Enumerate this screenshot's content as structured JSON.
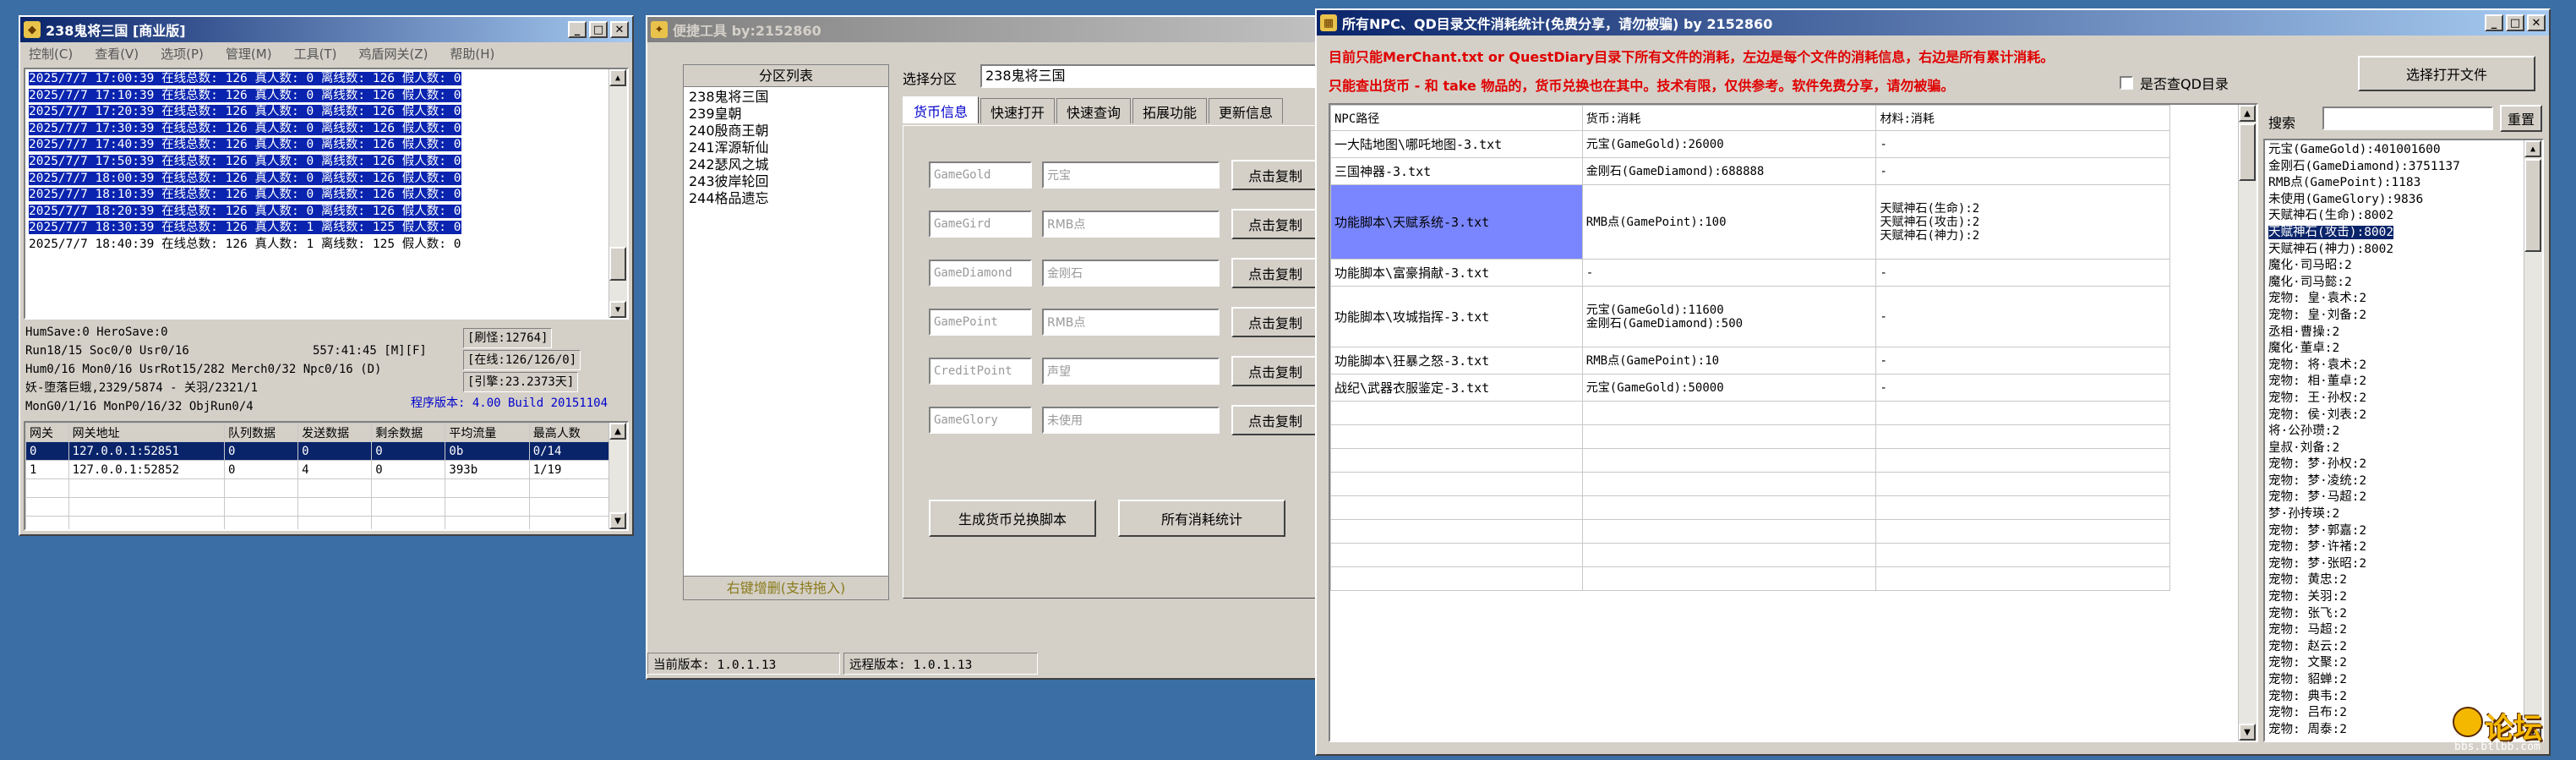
{
  "win1": {
    "title": "238鬼将三国 [商业版]",
    "menu": [
      "控制(C)",
      "查看(V)",
      "选项(P)",
      "管理(M)",
      "工具(T)",
      "鸡盾网关(Z)",
      "帮助(H)"
    ],
    "log": [
      {
        "text": "2025/7/7 17:00:39 在线总数: 126 真人数: 0 离线数: 126 假人数: 0",
        "selected": true
      },
      {
        "text": "2025/7/7 17:10:39 在线总数: 126 真人数: 0 离线数: 126 假人数: 0",
        "selected": true
      },
      {
        "text": "2025/7/7 17:20:39 在线总数: 126 真人数: 0 离线数: 126 假人数: 0",
        "selected": true
      },
      {
        "text": "2025/7/7 17:30:39 在线总数: 126 真人数: 0 离线数: 126 假人数: 0",
        "selected": true
      },
      {
        "text": "2025/7/7 17:40:39 在线总数: 126 真人数: 0 离线数: 126 假人数: 0",
        "selected": true
      },
      {
        "text": "2025/7/7 17:50:39 在线总数: 126 真人数: 0 离线数: 126 假人数: 0",
        "selected": true
      },
      {
        "text": "2025/7/7 18:00:39 在线总数: 126 真人数: 0 离线数: 126 假人数: 0",
        "selected": true
      },
      {
        "text": "2025/7/7 18:10:39 在线总数: 126 真人数: 0 离线数: 126 假人数: 0",
        "selected": true
      },
      {
        "text": "2025/7/7 18:20:39 在线总数: 126 真人数: 0 离线数: 126 假人数: 0",
        "selected": true
      },
      {
        "text": "2025/7/7 18:30:39 在线总数: 126 真人数: 1 离线数: 125 假人数: 0",
        "selected": true
      },
      {
        "text": "2025/7/7 18:40:39 在线总数: 126 真人数: 1 离线数: 125 假人数: 0",
        "selected": false
      }
    ],
    "stats": {
      "line1": "HumSave:0 HeroSave:0",
      "line2": "Run18/15 Soc0/0 Usr0/16",
      "uptime": "557:41:45 [M][F]",
      "refresh": "[刷怪:12764]",
      "online": "[在线:126/126/0]",
      "line3": "Hum0/16 Mon0/16 UsrRot15/282 Merch0/32 Npc0/16 (D)",
      "engine": "[引擎:23.2373天]",
      "line4": "妖-堕落巨蛾,2329/5874 - 关羽/2321/1",
      "line5": "MonG0/1/16 MonP0/16/32 ObjRun0/4",
      "version": "程序版本: 4.00 Build 20151104"
    },
    "gateway": {
      "headers": [
        "网关",
        "网关地址",
        "队列数据",
        "发送数据",
        "剩余数据",
        "平均流量",
        "最高人数"
      ],
      "rows": [
        [
          "0",
          "127.0.0.1:52851",
          "0",
          "0",
          "0",
          "0b",
          "0/14"
        ],
        [
          "1",
          "127.0.0.1:52852",
          "0",
          "4",
          "0",
          "393b",
          "1/19"
        ]
      ]
    }
  },
  "win2": {
    "title": "便捷工具   by:2152860",
    "zone_list_header": "分区列表",
    "zones": [
      "238鬼将三国",
      "239皇朝",
      "240殷商王朝",
      "241浑源斩仙",
      "242瑟风之城",
      "243彼岸轮回",
      "244格品遗忘"
    ],
    "zone_footer": "右键增删(支持拖入)",
    "select_zone_label": "选择分区",
    "select_zone_value": "238鬼将三国",
    "tabs": [
      "货币信息",
      "快速打开",
      "快速查询",
      "拓展功能",
      "更新信息"
    ],
    "currency_rows": [
      {
        "code": "GameGold",
        "name": "元宝",
        "button": "点击复制"
      },
      {
        "code": "GameGird",
        "name": "RMB点",
        "button": "点击复制"
      },
      {
        "code": "GameDiamond",
        "name": "金刚石",
        "button": "点击复制"
      },
      {
        "code": "GamePoint",
        "name": "RMB点",
        "button": "点击复制"
      },
      {
        "code": "CreditPoint",
        "name": "声望",
        "button": "点击复制"
      },
      {
        "code": "GameGlory",
        "name": "未使用",
        "button": "点击复制"
      }
    ],
    "btn_generate": "生成货币兑换脚本",
    "btn_stats": "所有消耗统计",
    "status_current": "当前版本: 1.0.1.13",
    "status_remote": "远程版本: 1.0.1.13"
  },
  "win3": {
    "title": "所有NPC、QD目录文件消耗统计(免费分享，请勿被骗)      by 2152860",
    "notice1": "目前只能MerChant.txt or QuestDiary目录下所有文件的消耗，左边是每个文件的消耗信息，右边是所有累计消耗。",
    "notice2": "只能查出货币 - 和 take 物品的，货币兑换也在其中。技术有限，仅供参考。软件免费分享，请勿被骗。",
    "checkbox_label": "是否查QD目录",
    "btn_open": "选择打开文件",
    "search_label": "搜索",
    "btn_reset": "重置",
    "table_headers": [
      "NPC路径",
      "货币:消耗",
      "材料:消耗"
    ],
    "table_rows": [
      {
        "path": "一大陆地图\\哪吒地图-3.txt",
        "money": [
          "元宝(GameGold):26000"
        ],
        "items": [
          "-"
        ]
      },
      {
        "path": "三国神器-3.txt",
        "money": [
          "金刚石(GameDiamond):688888"
        ],
        "items": [
          "-"
        ]
      },
      {
        "path": "功能脚本\\天赋系统-3.txt",
        "money": [
          "RMB点(GamePoint):100"
        ],
        "items": [
          "天赋神石(生命):2",
          "天赋神石(攻击):2",
          "天赋神石(神力):2"
        ],
        "selected": true
      },
      {
        "path": "功能脚本\\富豪捐献-3.txt",
        "money": [
          "-"
        ],
        "items": [
          "-"
        ]
      },
      {
        "path": "功能脚本\\攻城指挥-3.txt",
        "money": [
          "元宝(GameGold):11600",
          "金刚石(GameDiamond):500"
        ],
        "items": [
          "-"
        ]
      },
      {
        "path": "功能脚本\\狂暴之怒-3.txt",
        "money": [
          "RMB点(GamePoint):10"
        ],
        "items": [
          "-"
        ]
      },
      {
        "path": "战纪\\武器衣服鉴定-3.txt",
        "money": [
          "元宝(GameGold):50000"
        ],
        "items": [
          "-"
        ]
      }
    ],
    "totals": [
      "元宝(GameGold):401001600",
      "金刚石(GameDiamond):3751137",
      "RMB点(GamePoint):1183",
      "未使用(GameGlory):9836",
      "天赋神石(生命):8002",
      "天赋神石(攻击):8002",
      "天赋神石(神力):8002",
      "魔化·司马昭:2",
      "魔化·司马懿:2",
      "宠物: 皇·袁术:2",
      "宠物: 皇·刘备:2",
      "丞相·曹操:2",
      "魔化·董卓:2",
      "宠物: 将·袁术:2",
      "宠物: 相·董卓:2",
      "宠物: 王·孙权:2",
      "宠物: 侯·刘表:2",
      "将·公孙瓒:2",
      "皇叔·刘备:2",
      "宠物: 梦·孙权:2",
      "宠物: 梦·凌统:2",
      "宠物: 梦·马超:2",
      "梦·孙抟瑛:2",
      "宠物: 梦·郭嘉:2",
      "宠物: 梦·许褚:2",
      "宠物: 梦·张昭:2",
      "宠物: 黄忠:2",
      "宠物: 关羽:2",
      "宠物: 张飞:2",
      "宠物: 马超:2",
      "宠物: 赵云:2",
      "宠物: 文聚:2",
      "宠物: 貂蝉:2",
      "宠物: 典韦:2",
      "宠物: 吕布:2",
      "宠物: 周泰:2"
    ],
    "totals_selected_index": 5
  },
  "watermark": "bbs.btlbb.com",
  "watermark_brand": "论坛"
}
